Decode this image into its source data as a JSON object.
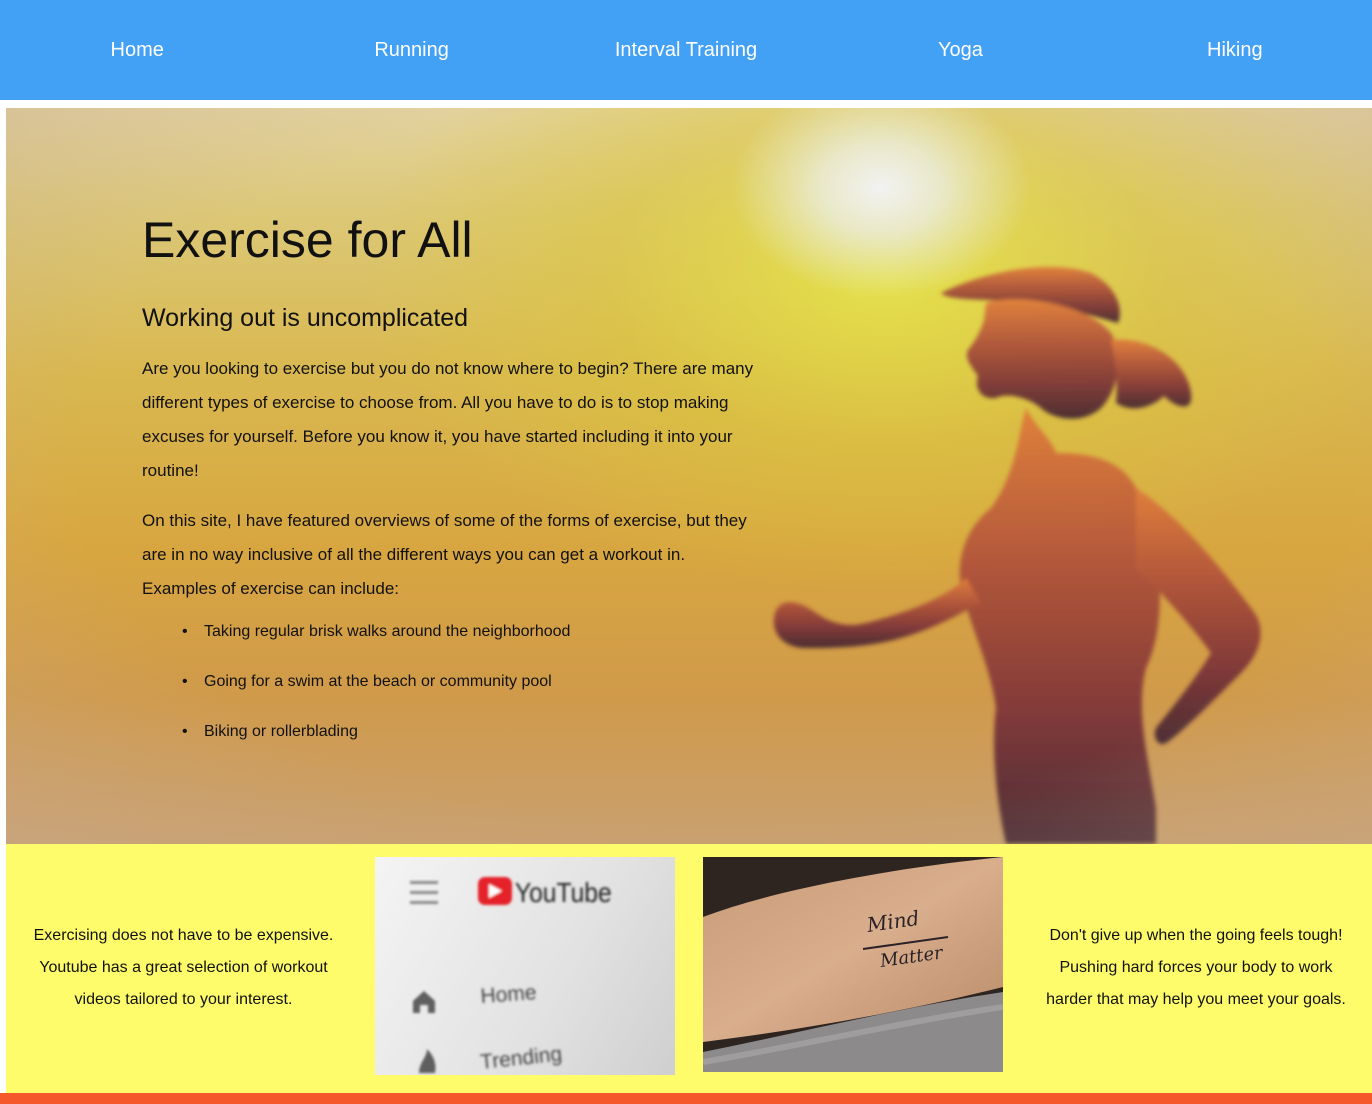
{
  "nav": {
    "items": [
      {
        "label": "Home"
      },
      {
        "label": "Running"
      },
      {
        "label": "Interval Training"
      },
      {
        "label": "Yoga"
      },
      {
        "label": "Hiking"
      }
    ]
  },
  "hero": {
    "title": "Exercise for All",
    "subtitle": "Working out is uncomplicated",
    "paragraph1": "Are you looking to exercise but you do not know where to begin? There are many different types of exercise to choose from. All you have to do is to stop making excuses for yourself. Before you know it, you have started including it into your routine!",
    "paragraph2": "On this site, I have featured overviews of some of the forms of exercise, but they are in no way inclusive of all the different ways you can get a workout in. Examples of exercise can include:",
    "list": [
      "Taking regular brisk walks around the neighborhood",
      "Going for a swim at the beach or community pool",
      "Biking or rollerblading"
    ]
  },
  "strip": {
    "left_text": "Exercising does not have to be expensive. Youtube has a great selection of workout videos tailored to your interest.",
    "right_text": "Don't give up when the going feels tough! Pushing hard forces your body to work harder that may help you meet your goals.",
    "youtube_photo": {
      "brand": "YouTube",
      "menu_items": [
        "Home",
        "Trending"
      ]
    },
    "tattoo_photo": {
      "lines": [
        "Mind",
        "Matter"
      ]
    }
  },
  "colors": {
    "nav": "#42a0f5",
    "strip": "#fefc6a",
    "footer": "#f5582a"
  }
}
